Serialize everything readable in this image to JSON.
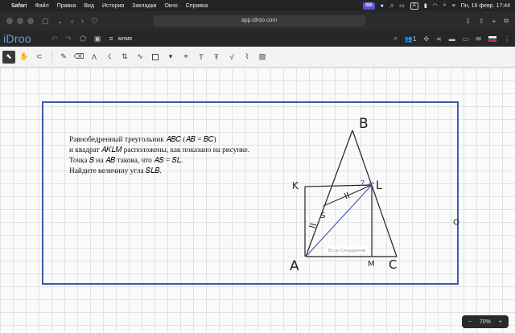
{
  "menubar": {
    "app": "Safari",
    "items": [
      "Файл",
      "Правка",
      "Вид",
      "История",
      "Закладки",
      "Окно",
      "Справка"
    ],
    "time": "Пн, 16 февр.  17:44"
  },
  "safari": {
    "url": "app.idroo.com"
  },
  "idroo": {
    "logo": "iDroo",
    "board_name": "млмв",
    "users_count": "1"
  },
  "problem": {
    "lines": [
      "Равнобедренный треугольник 𝐴𝐵𝐶 (𝐴𝐵 = 𝐵𝐶)",
      "и квадрат 𝐴𝐾𝐿𝑀 расположены, как показано на рисунке.",
      "Точка 𝑆 на 𝐴𝐵 такова, что 𝐴𝑆 = 𝑆𝐿.",
      "Найдите величину угла 𝑆𝐿𝐵."
    ]
  },
  "figure": {
    "labels": {
      "B": "B",
      "K": "K",
      "L": "L",
      "S": "S",
      "A": "A",
      "M": "M",
      "C": "C",
      "question": "?"
    },
    "author_tag": "Егор Скорданов"
  },
  "zoom": {
    "minus": "−",
    "value": "70%",
    "plus": "+"
  }
}
